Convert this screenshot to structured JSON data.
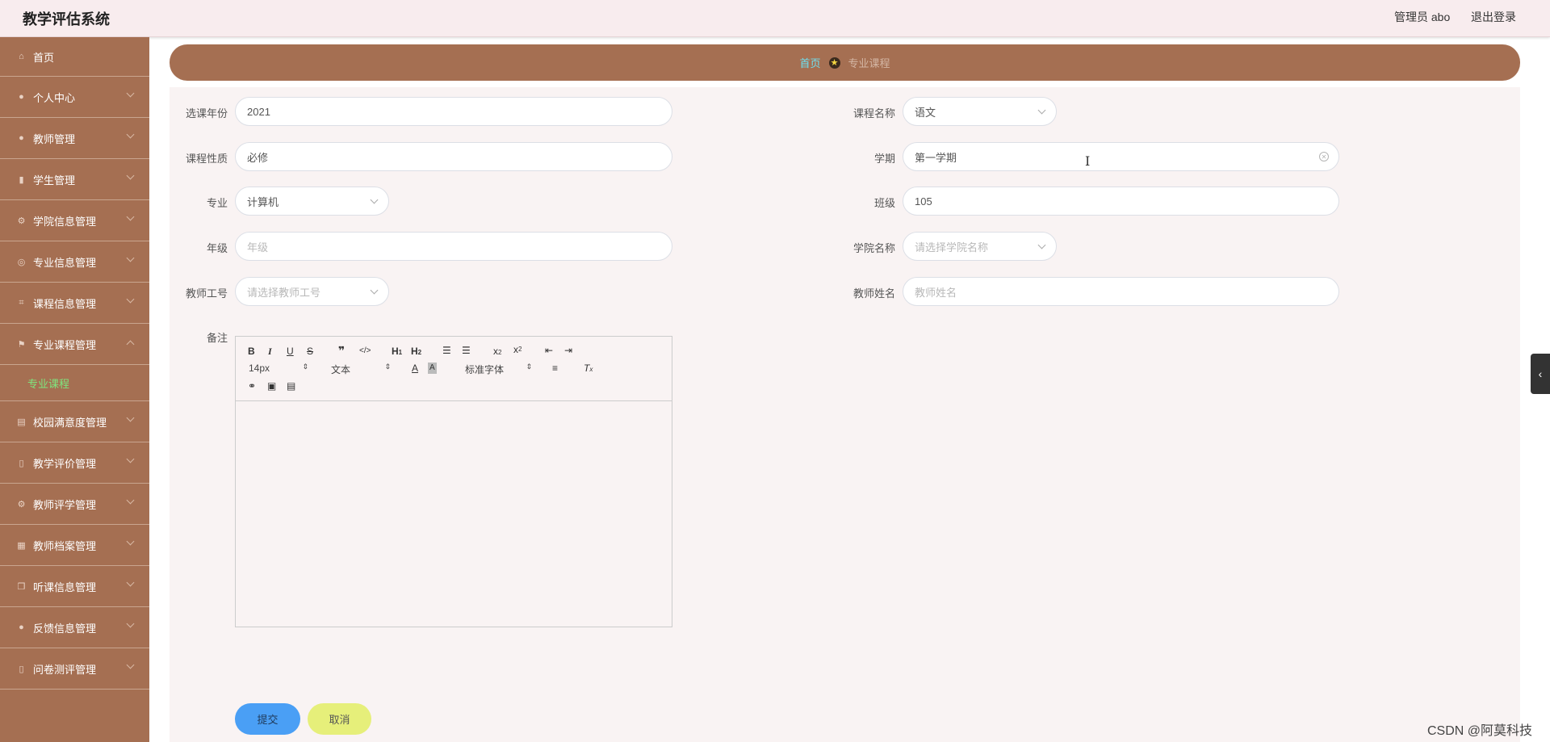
{
  "header": {
    "app_title": "教学评估系统",
    "admin_label": "管理员 abo",
    "logout_label": "退出登录"
  },
  "sidebar": {
    "items": [
      {
        "label": "首页",
        "icon": "home-icon"
      },
      {
        "label": "个人中心",
        "icon": "user-icon"
      },
      {
        "label": "教师管理",
        "icon": "user-icon"
      },
      {
        "label": "学生管理",
        "icon": "bar-chart-icon"
      },
      {
        "label": "学院信息管理",
        "icon": "settings-icon"
      },
      {
        "label": "专业信息管理",
        "icon": "globe-icon"
      },
      {
        "label": "课程信息管理",
        "icon": "crop-icon"
      },
      {
        "label": "专业课程管理",
        "icon": "flag-icon",
        "expanded": true
      },
      {
        "label": "校园满意度管理",
        "icon": "clipboard-icon"
      },
      {
        "label": "教学评价管理",
        "icon": "mic-icon"
      },
      {
        "label": "教师评学管理",
        "icon": "settings-icon"
      },
      {
        "label": "教师档案管理",
        "icon": "grid-icon"
      },
      {
        "label": "听课信息管理",
        "icon": "copy-icon"
      },
      {
        "label": "反馈信息管理",
        "icon": "user-icon"
      },
      {
        "label": "问卷测评管理",
        "icon": "mic-icon"
      }
    ],
    "sub_item": "专业课程"
  },
  "breadcrumb": {
    "home": "首页",
    "current": "专业课程"
  },
  "form": {
    "year_label": "选课年份",
    "year_value": "2021",
    "course_name_label": "课程名称",
    "course_name_value": "语文",
    "nature_label": "课程性质",
    "nature_value": "必修",
    "term_label": "学期",
    "term_value": "第一学期",
    "major_label": "专业",
    "major_value": "计算机",
    "class_label": "班级",
    "class_value": "105",
    "grade_label": "年级",
    "grade_placeholder": "年级",
    "college_label": "学院名称",
    "college_placeholder": "请选择学院名称",
    "teacher_id_label": "教师工号",
    "teacher_id_placeholder": "请选择教师工号",
    "teacher_name_label": "教师姓名",
    "teacher_name_placeholder": "教师姓名",
    "remark_label": "备注"
  },
  "editor": {
    "font_size": "14px",
    "header_select": "文本",
    "font_family": "标准字体"
  },
  "buttons": {
    "submit": "提交",
    "cancel": "取消"
  },
  "watermark": "CSDN @阿莫科技",
  "colors": {
    "sidebar_bg": "#a56f52",
    "breadcrumb_home": "#6fe0f0",
    "active_sub": "#7ee67e",
    "submit_bg": "#4a9ff5",
    "cancel_bg": "#e6ef7a"
  }
}
